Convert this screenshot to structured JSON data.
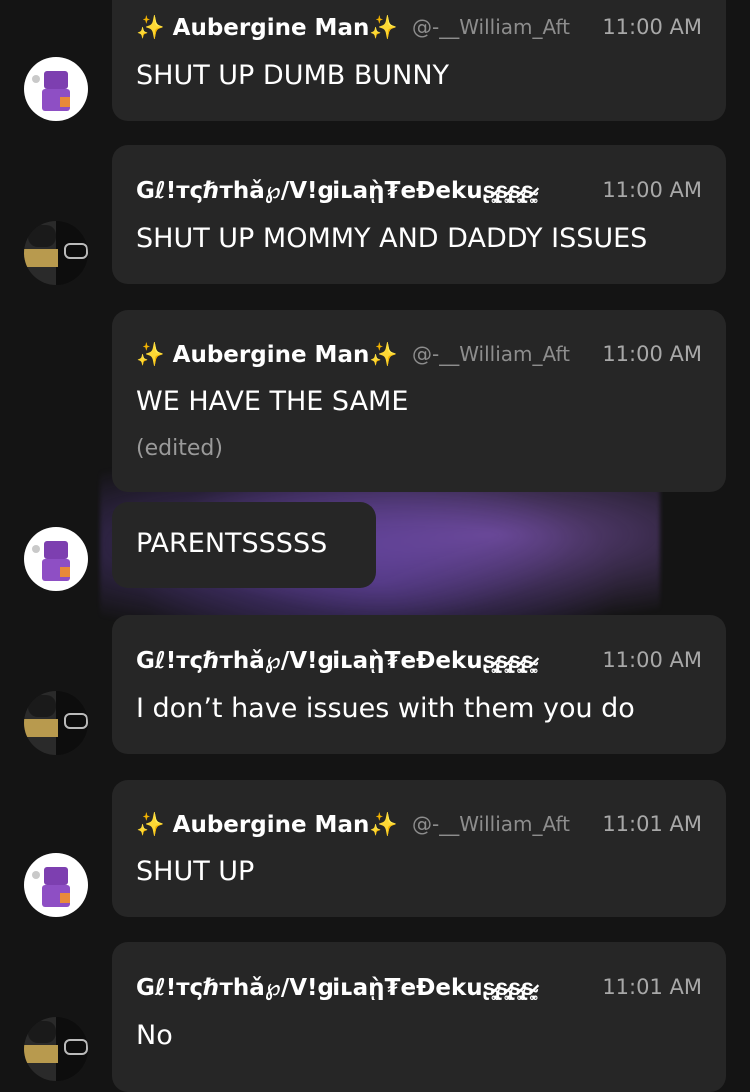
{
  "messages": [
    {
      "username": "✨ Aubergine Man✨",
      "handle": "@-__William_Aft",
      "time": "11:00 AM",
      "text": "SHUT UP DUMB BUNNY",
      "avatar": "purple-pixel-avatar"
    },
    {
      "username": "Gℓ!тςℏтhǎ℘/V!ցiʟaῂ₮eĐekuʂ̴̷͚͙ʂ̴̷͚͙ʂ̴̷͚͙ʂ̴̷͚͙",
      "time": "11:00 AM",
      "text": "SHUT UP MOMMY AND DADDY ISSUES",
      "avatar": "dark-masked-avatar"
    },
    {
      "username": "✨ Aubergine Man✨",
      "handle": "@-__William_Aft",
      "time": "11:00 AM",
      "text": "WE HAVE THE SAME",
      "edited": "(edited)",
      "avatar": "purple-pixel-avatar"
    },
    {
      "text": "PARENTSSSSS",
      "avatar": "purple-pixel-avatar"
    },
    {
      "username": "Gℓ!тςℏтhǎ℘/V!ցiʟaῂ₮eĐekuʂ̴̷͚͙ʂ̴̷͚͙ʂ̴̷͚͙ʂ̴̷͚͙",
      "time": "11:00 AM",
      "text": "I don’t have issues with them you do",
      "avatar": "dark-masked-avatar"
    },
    {
      "username": "✨ Aubergine Man✨",
      "handle": "@-__William_Aft",
      "time": "11:01 AM",
      "text": "SHUT UP",
      "avatar": "purple-pixel-avatar"
    },
    {
      "username": "Gℓ!тςℏтhǎ℘/V!ցiʟaῂ₮eĐekuʂ̴̷͚͙ʂ̴̷͚͙ʂ̴̷͚͙ʂ̴̷͚͙",
      "time": "11:01 AM",
      "text": "No",
      "avatar": "dark-masked-avatar"
    }
  ],
  "colors": {
    "background": "#141414",
    "bubble": "#262626",
    "timestamp": "#a8a8a8",
    "handle": "#8d8d8d"
  }
}
